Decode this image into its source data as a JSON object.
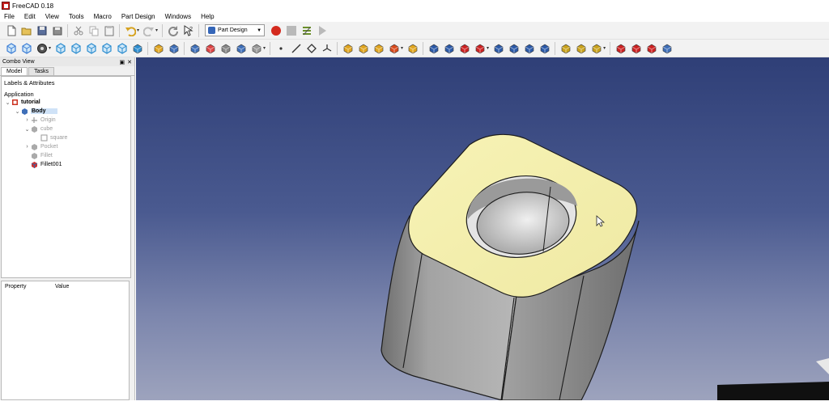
{
  "window": {
    "title": "FreeCAD 0.18"
  },
  "menu": [
    "File",
    "Edit",
    "View",
    "Tools",
    "Macro",
    "Part Design",
    "Windows",
    "Help"
  ],
  "toolbar": {
    "workbench_selected": "Part Design",
    "icons_row1": [
      "new-file-icon",
      "open-file-icon",
      "save-icon",
      "save-as-icon",
      "cut-icon",
      "copy-icon",
      "paste-icon",
      "undo-icon",
      "redo-icon",
      "refresh-icon",
      "whats-this-icon",
      "workbench-selector",
      "macro-record-icon",
      "macro-stop-icon",
      "macro-edit-icon",
      "macro-run-icon"
    ],
    "icons_row2": [
      "fit-all-icon",
      "fit-selection-icon",
      "draw-style-icon",
      "view-isometric-icon",
      "view-front-icon",
      "view-top-icon",
      "view-right-icon",
      "view-rear-icon",
      "measure-icon",
      "part-icon",
      "group-icon",
      "body-icon",
      "sketch-icon",
      "validate-sketch-icon",
      "shape-binder-icon",
      "clone-icon",
      "point-icon",
      "line-icon",
      "plane-icon",
      "lcs-icon",
      "pad-icon",
      "revolution-icon",
      "pocket-icon",
      "hole-icon",
      "groove-icon",
      "fillet-icon",
      "chamfer-icon",
      "draft-icon",
      "thickness-icon",
      "mirrored-icon",
      "linear-pattern-icon",
      "polar-pattern-icon",
      "multi-transform-icon",
      "additive-pipe-icon",
      "additive-loft-icon",
      "additive-box-icon",
      "subtractive-box-icon",
      "subtractive-pipe-icon",
      "subtractive-loft-icon",
      "boolean-icon"
    ]
  },
  "combo_view": {
    "title": "Combo View",
    "tabs": [
      "Model",
      "Tasks"
    ],
    "active_tab": "Model",
    "tree_title": "Labels & Attributes",
    "application_label": "Application",
    "tree": [
      {
        "label": "tutorial",
        "level": 0,
        "expander": "v",
        "icon": "document-icon",
        "bold": true
      },
      {
        "label": "Body",
        "level": 1,
        "expander": "v",
        "icon": "body-icon",
        "bold": true,
        "selected": true
      },
      {
        "label": "Origin",
        "level": 2,
        "expander": ">",
        "icon": "origin-icon",
        "dim": true
      },
      {
        "label": "cube",
        "level": 2,
        "expander": "v",
        "icon": "pad-feature-icon",
        "dim": true
      },
      {
        "label": "square",
        "level": 3,
        "expander": "",
        "icon": "sketch-icon",
        "dim": true
      },
      {
        "label": "Pocket",
        "level": 2,
        "expander": ">",
        "icon": "pocket-feature-icon",
        "dim": true
      },
      {
        "label": "Fillet",
        "level": 2,
        "expander": "",
        "icon": "fillet-feature-icon",
        "dim": true
      },
      {
        "label": "Fillet001",
        "level": 2,
        "expander": "",
        "icon": "fillet-tip-icon"
      }
    ],
    "property_header": [
      "Property",
      "Value"
    ]
  },
  "viewport": {
    "background_top": "#2f3f77",
    "background_bottom": "#9da3bd",
    "model_top_face_color": "#f6f2ad",
    "model_side_color": "#8d8d8d"
  }
}
